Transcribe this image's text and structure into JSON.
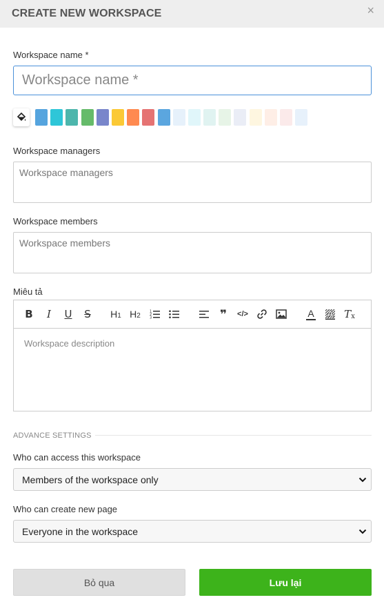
{
  "dialog": {
    "title": "CREATE NEW WORKSPACE",
    "close_glyph": "×"
  },
  "name_field": {
    "label": "Workspace name *",
    "placeholder": "Workspace name *",
    "value": ""
  },
  "palette": {
    "icon": "paint-bucket-icon",
    "colors": [
      "#55a4de",
      "#2ec6d8",
      "#4db6ac",
      "#66bb6a",
      "#7986cb",
      "#fbc935",
      "#ff8a50",
      "#e57373",
      "#5ba6df",
      "#e6f1fb",
      "#e0f6fa",
      "#e0f3f1",
      "#e7f4e7",
      "#eaedf6",
      "#fef6e0",
      "#feeee6",
      "#fbeaea",
      "#e7f1fb"
    ]
  },
  "managers_field": {
    "label": "Workspace managers",
    "placeholder": "Workspace managers"
  },
  "members_field": {
    "label": "Workspace members",
    "placeholder": "Workspace members"
  },
  "description": {
    "label": "Miêu tả",
    "placeholder": "Workspace description",
    "toolbar": {
      "bold": "B",
      "italic": "I",
      "underline": "U",
      "strike": "S",
      "h1": "H1",
      "h2": "H2",
      "h1_base": "H",
      "h1_sub": "1",
      "h2_base": "H",
      "h2_sub": "2",
      "quote": "❞",
      "code": "</>",
      "text_color": "A",
      "clear_base": "T",
      "clear_sub": "x"
    }
  },
  "advanced": {
    "label": "ADVANCE SETTINGS",
    "access_label": "Who can access this workspace",
    "access_value": "Members of the workspace only",
    "create_label": "Who can create new page",
    "create_value": "Everyone in the workspace"
  },
  "buttons": {
    "cancel": "Bỏ qua",
    "save": "Lưu lại"
  },
  "colors": {
    "accent_border": "#4a90d9",
    "save_green": "#3db31b"
  }
}
